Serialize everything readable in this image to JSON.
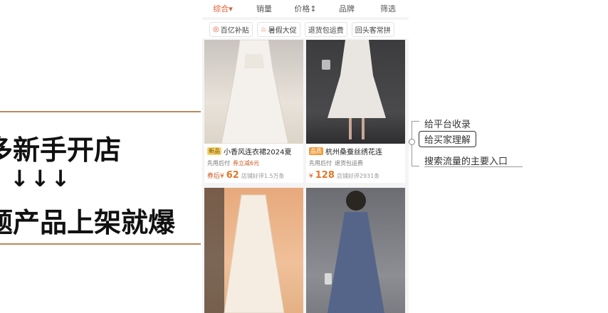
{
  "slide": {
    "line1": "多新手开店",
    "arrows": "↓↓↓",
    "line2": "题产品上架就爆"
  },
  "sort_bar": {
    "items": [
      "综合▾",
      "销量",
      "价格↕",
      "品牌",
      "筛选"
    ]
  },
  "tags": [
    {
      "icon": "coupon-icon",
      "label": "百亿补贴"
    },
    {
      "icon": "flame-icon",
      "label": "暑假大促"
    },
    {
      "icon": "",
      "label": "退货包运费"
    },
    {
      "icon": "",
      "label": "回头客常拼"
    }
  ],
  "products": [
    {
      "badge": "新品",
      "title": "小香风连衣裙2024夏",
      "meta1": "先用后付",
      "meta2": "券立减6元",
      "price_prefix": "券后¥",
      "price": "62",
      "sales": "店铺好评1.5万条"
    },
    {
      "badge": "品质",
      "title": "杭州桑蚕丝绣花连",
      "meta1": "先用后付",
      "meta2": "退货包运费",
      "price_prefix": "¥",
      "price": "128",
      "sales": "店铺好评2931条"
    }
  ],
  "annotations": {
    "a1": "给平台收录",
    "a2": "给买家理解",
    "a3": "搜索流量的主要入口"
  },
  "colors": {
    "accent": "#e05a2b",
    "slide_border": "#b58a5c"
  }
}
